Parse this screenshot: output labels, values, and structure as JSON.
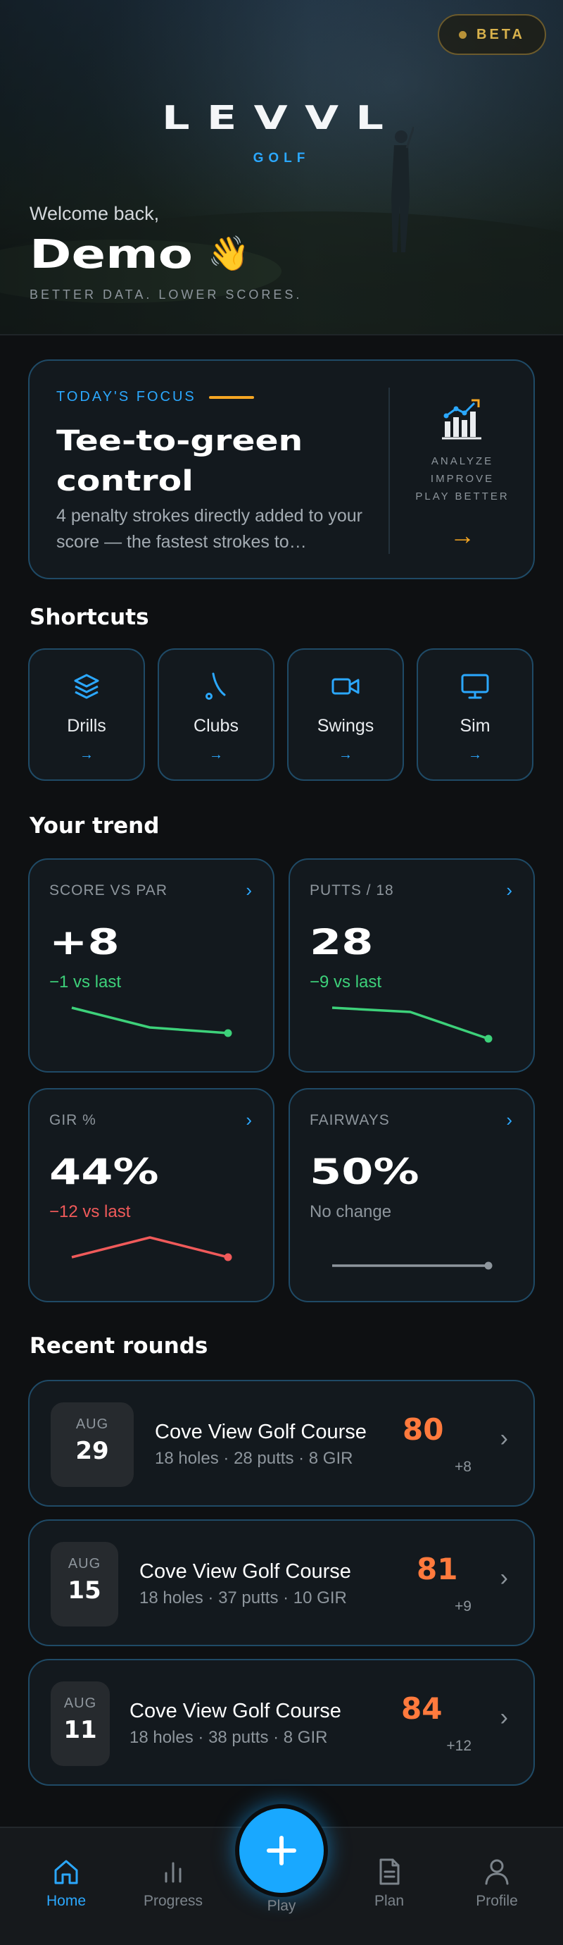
{
  "hero": {
    "badge": "BETA",
    "logo": "LEVVL",
    "logo_sub": "GOLF",
    "welcome": "Welcome back,",
    "user_name": "Demo",
    "wave_emoji": "👋",
    "tagline": "BETTER DATA. LOWER SCORES."
  },
  "focus": {
    "eyebrow": "TODAY'S FOCUS",
    "title_line1": "Tee-to-green",
    "title_line2": "control",
    "description": "4 penalty strokes directly added to your score — the fastest strokes to…",
    "side_lines": [
      "ANALYZE",
      "IMPROVE",
      "PLAY BETTER"
    ],
    "arrow": "→"
  },
  "shortcuts": {
    "heading": "Shortcuts",
    "items": [
      {
        "label": "Drills",
        "icon": "layers-icon",
        "arrow": "→"
      },
      {
        "label": "Clubs",
        "icon": "golf-club-icon",
        "arrow": "→"
      },
      {
        "label": "Swings",
        "icon": "video-camera-icon",
        "arrow": "→"
      },
      {
        "label": "Sim",
        "icon": "monitor-icon",
        "arrow": "→"
      }
    ]
  },
  "trend": {
    "heading": "Your trend",
    "cards": [
      {
        "label": "SCORE VS PAR",
        "value": "+8",
        "delta": "−1 vs last",
        "status": "improved",
        "color": "#3dd17a",
        "trend_points": [
          3,
          1.6,
          1.2
        ]
      },
      {
        "label": "PUTTS / 18",
        "value": "28",
        "delta": "−9 vs last",
        "status": "improved",
        "color": "#3dd17a",
        "trend_points": [
          3,
          2.7,
          0.8
        ]
      },
      {
        "label": "GIR %",
        "value": "44%",
        "delta": "−12 vs last",
        "status": "declined",
        "color": "#f05a5a",
        "trend_points": [
          1.6,
          3,
          1.6
        ]
      },
      {
        "label": "FAIRWAYS",
        "value": "50%",
        "delta": "No change",
        "status": "flat",
        "color": "#8e969d",
        "trend_points": [
          1,
          1,
          1
        ]
      }
    ]
  },
  "recent": {
    "heading": "Recent rounds",
    "rounds": [
      {
        "month": "AUG",
        "day": "29",
        "course": "Cove View Golf Course",
        "meta": "18 holes · 28 putts · 8 GIR",
        "score": "80",
        "relative": "+8"
      },
      {
        "month": "AUG",
        "day": "15",
        "course": "Cove View Golf Course",
        "meta": "18 holes · 37 putts · 10 GIR",
        "score": "81",
        "relative": "+9"
      },
      {
        "month": "AUG",
        "day": "11",
        "course": "Cove View Golf Course",
        "meta": "18 holes · 38 putts · 8 GIR",
        "score": "84",
        "relative": "+12"
      }
    ]
  },
  "nav": {
    "items": [
      {
        "label": "Home",
        "icon": "home-icon",
        "active": true
      },
      {
        "label": "Progress",
        "icon": "bar-chart-icon",
        "active": false
      },
      {
        "label": "Play",
        "icon": "plus-icon",
        "active": false
      },
      {
        "label": "Plan",
        "icon": "document-icon",
        "active": false
      },
      {
        "label": "Profile",
        "icon": "user-icon",
        "active": false
      }
    ]
  },
  "colors": {
    "accent": "#2ba8ff",
    "highlight": "#f5a623",
    "score": "#ff7a3d",
    "positive": "#3dd17a",
    "negative": "#f05a5a",
    "card_border": "#1f4a66"
  }
}
